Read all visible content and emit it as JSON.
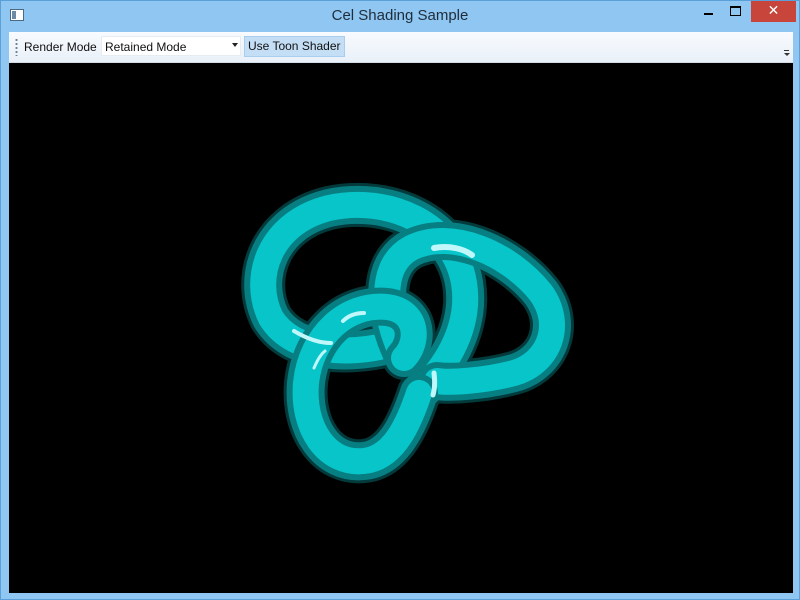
{
  "window": {
    "title": "Cel Shading Sample"
  },
  "toolbar": {
    "render_mode_label": "Render Mode",
    "render_mode_value": "Retained Mode",
    "toon_shader_label": "Use Toon Shader"
  },
  "viewport": {
    "model_icon": "trefoil-knot",
    "colors": {
      "background": "#000000",
      "knot_base": "#08c5c9",
      "knot_shadow": "#077f82",
      "knot_dark": "#055a5c",
      "highlight": "#bff7fb"
    }
  },
  "caption_icons": [
    "minimize-icon",
    "maximize-icon",
    "close-icon"
  ]
}
